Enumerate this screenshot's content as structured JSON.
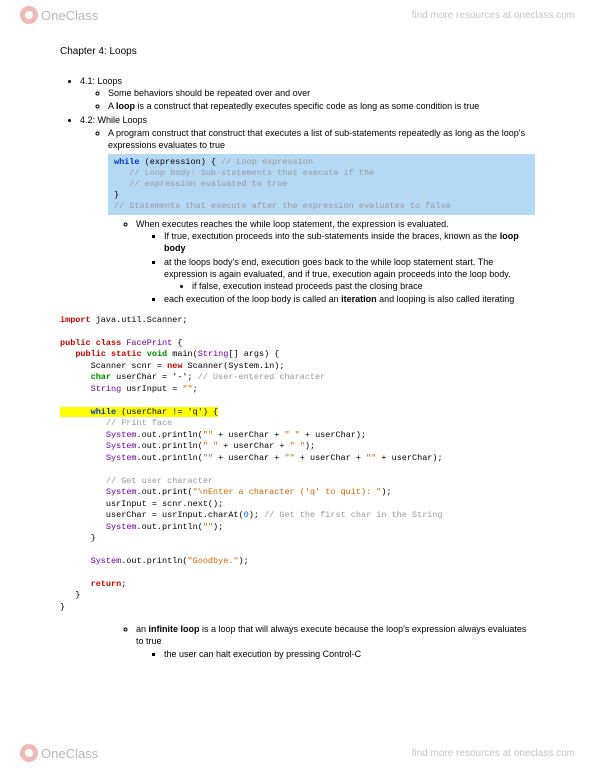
{
  "brand": {
    "one": "One",
    "class": "Class"
  },
  "header_link": "find more resources at oneclass.com",
  "chapter": "Chapter 4: Loops",
  "s41": {
    "title": "4.1: Loops",
    "b1": "Some behaviors should be repeated over and over",
    "b2a": "A ",
    "b2b": "loop",
    "b2c": " is a construct that repeatedly executes specific code as long as some condition is true"
  },
  "s42": {
    "title": "4.2: While Loops",
    "b1": "A program construct that construct that executes a list of sub-statements repeatedly as long as the loop's expressions evaluates to true"
  },
  "cb": {
    "l1a": "while",
    "l1b": " (expression) { ",
    "l1c": "// Loop expression",
    "l2": "   // Loop body: Sub-statements that execute if the",
    "l3": "   // expression evaluated to true",
    "l4": "}",
    "l5": "// Statements that execute after the expression evaluates to false"
  },
  "after": {
    "b1": "When executes reaches the while loop statement, the expression is evaluated.",
    "b2a": "If true, exectution proceeds into the sub-statements inside the braces, known as the ",
    "b2b": "loop body",
    "b3": "at the loops body's end, execution goes back to the while loop statement start. The expression is again evaluated, and if true, execution again proceeds into the loop body.",
    "b4": "if false, execution instead proceeds past the closing brace",
    "b5a": "each execution of the loop body is called an ",
    "b5b": "iteration",
    "b5c": " and looping is also called iterating"
  },
  "prog": {
    "import_kw": "import",
    "import_pkg": " java.util.Scanner;",
    "public": "public",
    "class_kw": "class",
    "classname": " FacePrint ",
    "static_kw": "static",
    "void_kw": "void",
    "main": " main",
    "string": "String",
    "args": "[] args) {",
    "scanner1": "      Scanner scnr = ",
    "new_kw": "new",
    "scanner2": " Scanner(System.in);",
    "char_kw": "char",
    "char_line": " userChar = '-'; ",
    "char_comment": "// User-entered character",
    "string_kw": "String",
    "string_line": " usrInput = ",
    "empty_str": "\"\"",
    "semi": ";",
    "while_kw": "while",
    "while_cond": " (userChar != 'q') {",
    "print_face": "         // Print face",
    "sys": "System",
    "out": ".out.println(",
    "outp": ".out.print(",
    "q1": "\"\"",
    "plus": " + userChar + ",
    "q_sp": "\" \"",
    "q_end": " + userChar);",
    "line2_mid": "\" \"",
    "line3_end": " + userChar + ",
    "get_comment": "         // Get user character",
    "enter_str": "\"\\nEnter a character ('q' to quit): \"",
    "next_line": "         usrInput = scnr.next();",
    "charAt": "         userChar = usrInput.charAt(",
    "zero": "0",
    "charAt2": "); ",
    "charAt_comment": "// Get the first char in the String",
    "println_empty": "         System.out.println(",
    "goodbye": "\"Goodbye.\"",
    "return_kw": "return",
    "close1": "      }",
    "close2": "   }",
    "close3": "}"
  },
  "bottom": {
    "b1a": "an ",
    "b1b": "infinite loop",
    "b1c": " is a loop that will always execute because the loop's expression always evaluates to true",
    "b2": "the user can halt execution by pressing Control-C"
  }
}
